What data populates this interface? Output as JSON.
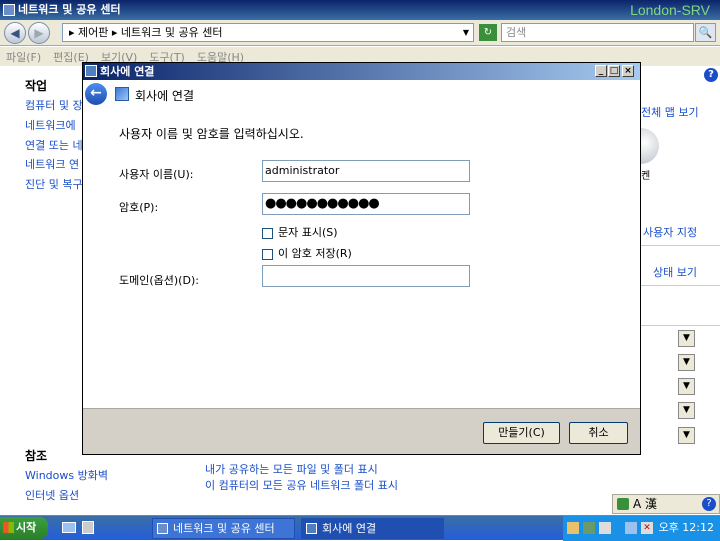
{
  "background_window": {
    "title": "네트워크 및 공유 센터",
    "watermark": "London-SRV",
    "address": {
      "back_icon": "back-arrow-icon",
      "forward_icon": "forward-arrow-icon",
      "breadcrumb": "▸ 제어판 ▸ 네트워크 및 공유 센터",
      "search_placeholder": "검색"
    },
    "menu": [
      "파일(F)",
      "편집(E)",
      "보기(V)",
      "도구(T)",
      "도움말(H)"
    ],
    "sidebar": {
      "tasks_heading": "작업",
      "tasks": [
        "컴퓨터 및 장",
        "네트워크에",
        "연결 또는 네",
        "네트워크 연",
        "진단 및 복구"
      ],
      "see_also_heading": "참조",
      "see_also": [
        "Windows 방화벽",
        "인터넷 옵션"
      ]
    },
    "right_links": [
      "전체 맵 보기",
      "사용자 지정",
      "상태 보기"
    ],
    "right_caption": "켄",
    "bottom_links": [
      "내가 공유하는 모든 파일 및 폴더 표시",
      "이 컴퓨터의 모든 공유 네트워크 폴더 표시"
    ]
  },
  "dialog": {
    "title": "회사에 연결",
    "header_title": "회사에 연결",
    "instruction": "사용자 이름 및 암호를 입력하십시오.",
    "username_label": "사용자 이름(U):",
    "username_value": "administrator",
    "password_label": "암호(P):",
    "password_value": "●●●●●●●●●●●",
    "show_chars_label": "문자 표시(S)",
    "show_chars_checked": false,
    "remember_label": "이 암호 저장(R)",
    "remember_checked": false,
    "domain_label": "도메인(옵션)(D):",
    "domain_value": "",
    "create_button": "만들기(C)",
    "cancel_button": "취소"
  },
  "taskbar": {
    "start_label": "시작",
    "items": [
      "네트워크 및 공유 센터",
      "회사에 연결"
    ],
    "clock": "오후 12:12"
  },
  "language_bar": "A 漢"
}
